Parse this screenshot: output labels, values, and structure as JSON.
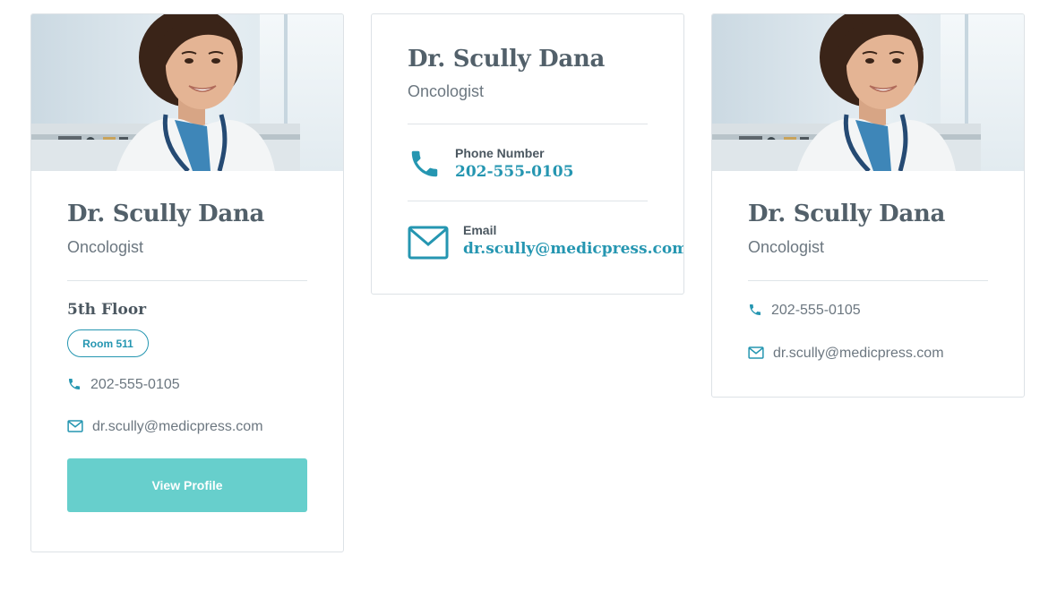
{
  "colors": {
    "accent": "#2596b1",
    "button": "#67cfcc",
    "heading": "#52606a",
    "muted_text": "#6c7780",
    "border": "#dde2e6"
  },
  "cards": [
    {
      "photo_alt": "doctor-portrait",
      "name": "Dr. Scully Dana",
      "role": "Oncologist",
      "floor": "5th Floor",
      "room": "Room 511",
      "phone": "202-555-0105",
      "email": "dr.scully@medicpress.com",
      "button_label": "View Profile",
      "icons": {
        "phone": "phone-icon",
        "email": "envelope-icon"
      }
    },
    {
      "name": "Dr. Scully Dana",
      "role": "Oncologist",
      "phone_label": "Phone Number",
      "phone": "202-555-0105",
      "email_label": "Email",
      "email": "dr.scully@medicpress.com",
      "icons": {
        "phone": "phone-icon",
        "email": "envelope-icon"
      }
    },
    {
      "photo_alt": "doctor-portrait",
      "name": "Dr. Scully Dana",
      "role": "Oncologist",
      "phone": "202-555-0105",
      "email": "dr.scully@medicpress.com",
      "icons": {
        "phone": "phone-icon",
        "email": "envelope-icon"
      }
    }
  ]
}
